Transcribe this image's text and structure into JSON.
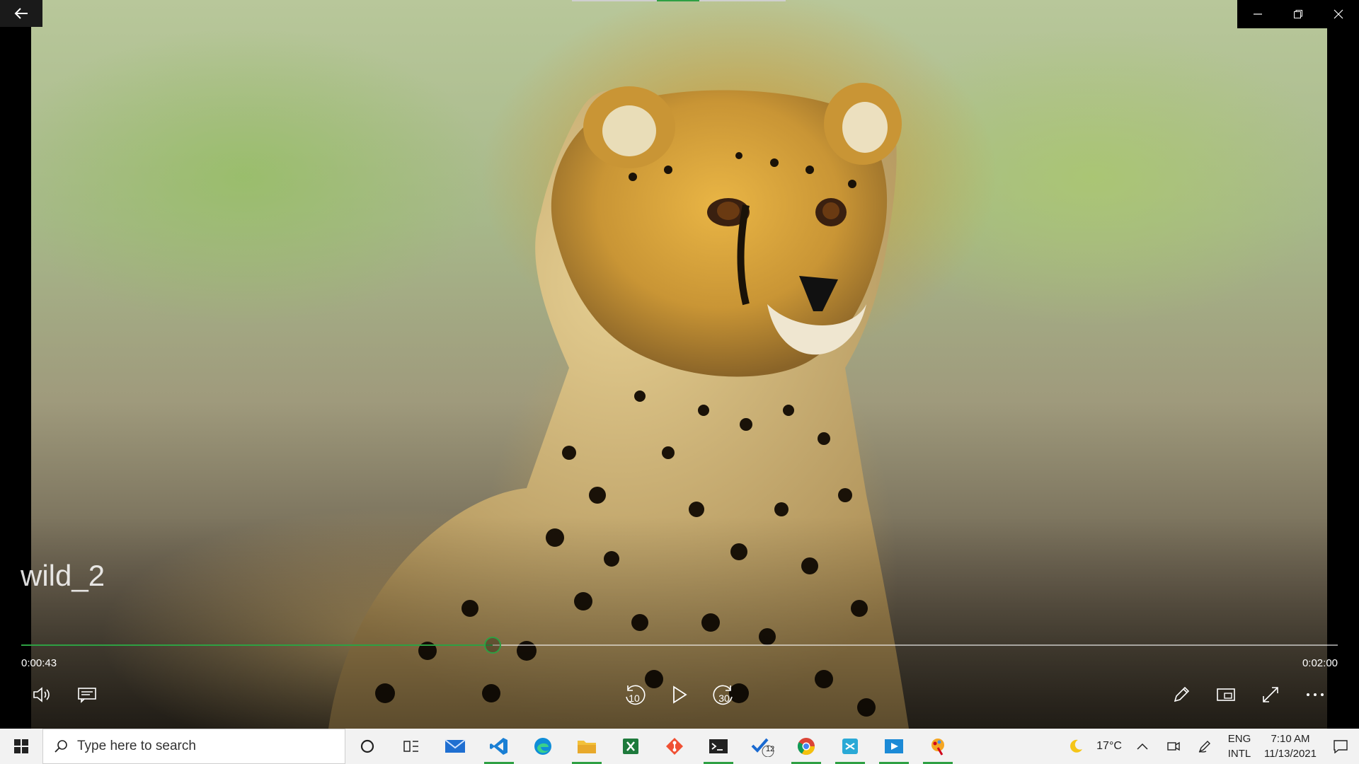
{
  "window": {
    "title": "wild_2"
  },
  "playback": {
    "current_time": "0:00:43",
    "total_time": "0:02:00",
    "progress": 0.358
  },
  "controls": {
    "skip_back_label": "10",
    "skip_forward_label": "30"
  },
  "taskbar": {
    "search_placeholder": "Type here to search",
    "weather": "17°C",
    "language": "ENG",
    "layout": "INTL",
    "time": "7:10 AM",
    "date": "11/13/2021",
    "todo_badge": "12"
  },
  "colors": {
    "accent": "#2ea043"
  }
}
